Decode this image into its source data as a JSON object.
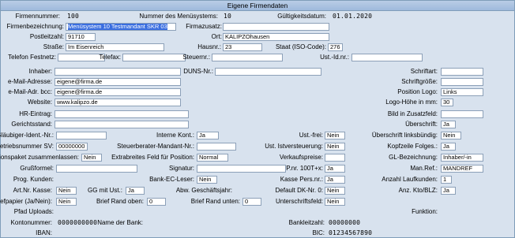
{
  "window": {
    "title": "Eigene Firmendaten"
  },
  "header": {
    "firmennummer_label": "Firmennummer:",
    "firmennummer": "100",
    "mandantsys_label": "Nummer des Menüsystems:",
    "mandantsys": "10",
    "gueltig_label": "Gültigkeitsdatum:",
    "gueltig": "01.01.2020"
  },
  "firma": {
    "bezeichnung_label": "Firmenbezeichnung:",
    "bezeichnung": "Menüsystem 10 Testmandant SKR 03",
    "zusatz_label": "Firmazusatz:",
    "zusatz": "",
    "plz_label": "Postleitzahl:",
    "plz": "91710",
    "ort_label": "Ort:",
    "ort": "KALIPZOhausen",
    "strasse_label": "Straße:",
    "strasse": "Im Eisenreich",
    "hausnr_label": "Hausnr.:",
    "hausnr": "23",
    "staat_label": "Staat (ISO-Code):",
    "staat": "276",
    "telefon_label": "Telefon Festnetz:",
    "telefon": "",
    "telefax_label": "Telefax:",
    "telefax": "",
    "steuernr_label": "Steuernr.:",
    "steuernr": "",
    "ustid_label": "Ust.-Id.nr.:",
    "ustid": "",
    "inhaber_label": "Inhaber:",
    "inhaber": "",
    "duns_label": "DUNS-Nr.:",
    "duns": "",
    "email_label": "e-Mail-Adresse:",
    "email": "eigene@firma.de",
    "email_bcc_label": "e-Mail-Adr. bcc:",
    "email_bcc": "eigene@firma.de",
    "website_label": "Website:",
    "website": "www.kalipzo.de",
    "hr_label": "HR-Eintrag:",
    "hr": "",
    "gericht_label": "Gerichtsstand:",
    "gericht": ""
  },
  "right": {
    "schriftart_label": "Schriftart:",
    "schriftart": "",
    "schriftgroesse_label": "Schriftgröße:",
    "schriftgroesse": "",
    "position_logo_label": "Position Logo:",
    "position_logo": "Links",
    "logo_hoehe_label": "Logo-Höhe in mm:",
    "logo_hoehe": "30",
    "bild_zusatz_label": "Bild in Zusatzfeld:",
    "bild_zusatz": "",
    "ueberschrift_label": "Überschrift:",
    "ueberschrift": "Ja",
    "ueberschrift_lb_label": "Überschrift linksbündig:",
    "ueberschrift_lb": "Nein",
    "kopfzeile_label": "Kopfzeile Folges.:",
    "kopfzeile": "Ja",
    "gl_label": "GL-Bezeichnung:",
    "gl": "Inhaber/-in",
    "manref_label": "Man.Ref.:",
    "manref": "MANDREF",
    "laufkunden_label": "Anzahl Laufkunden:",
    "laufkunden": "1",
    "anzkto_label": "Anz. Kto/BLZ:",
    "anzkto": "Ja",
    "funktion_label": "Funktion:"
  },
  "lower": {
    "glaeubiger_label": "Gläubiger-Ident.-Nr.:",
    "glaeubiger": "",
    "interne_kont_label": "Interne Kont.:",
    "interne_kont": "Ja",
    "ust_frei_label": "Ust.-frei:",
    "ust_frei": "Nein",
    "betriebsnr_label": "Betriebsnummer SV:",
    "betriebsnr": "00000000",
    "stb_label": "Steuerberater-Mandant-Nr.:",
    "stb": "",
    "ist_label": "Ust. Istversteuerung:",
    "ist": "Nein",
    "aktionspaket_label": "Aktionspaket zusammenlassen:",
    "aktionspaket": "Nein",
    "extrabreites_label": "Extrabreites Feld für Position:",
    "extrabreites": "Normal",
    "verkaufspreise_label": "Verkaufspreise:",
    "verkaufspreise": "",
    "grussformel_label": "Grußformel:",
    "grussformel": "",
    "signatur_label": "Signatur:",
    "signatur": "",
    "pnr_label": "P.nr. 100T+x:",
    "pnr": "Ja",
    "prog_kunden_label": "Prog. Kunden:",
    "bank_ec_label": "Bank-EC-Leser:",
    "bank_ec": "Nein",
    "kasse_pers_label": "Kasse Pers.nr.:",
    "kasse_pers": "Ja",
    "artnr_kasse_label": "Art.Nr. Kasse:",
    "artnr_kasse": "Nein",
    "gg_ust_label": "GG mit Ust.:",
    "gg_ust": "Ja",
    "abw_gj_label": "Abw. Geschäftsjahr:",
    "default_dk_label": "Default DK-Nr. 0:",
    "default_dk": "Nein",
    "briefpapier_label": "Briefpapier (Ja/Nein):",
    "briefpapier": "Nein",
    "rand_oben_label": "Brief Rand oben:",
    "rand_oben": "0",
    "rand_unten_label": "Brief Rand unten:",
    "rand_unten": "0",
    "unterschrift_label": "Unterschriftsfeld:",
    "unterschrift": "Nein",
    "pfad_label": "Pfad Uploads:"
  },
  "bank": {
    "kontonummer_label": "Kontonummer:",
    "kontonummer": "0000000000",
    "bankname_label": "Name der Bank:",
    "blz_label": "Bankleitzahl:",
    "blz": "00000000",
    "iban_label": "IBAN:",
    "bic_label": "BIC:",
    "bic": "01234567890"
  }
}
